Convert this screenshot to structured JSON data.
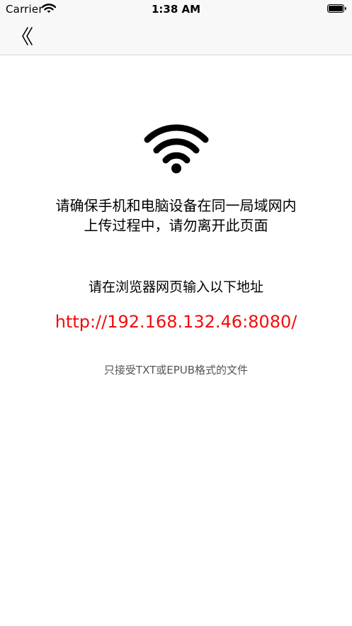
{
  "status_bar": {
    "carrier": "Carrier",
    "time": "1:38 AM",
    "wifi_icon": "wifi-icon",
    "battery_icon": "battery-icon"
  },
  "nav": {
    "back_icon": "chevron-left-icon"
  },
  "content": {
    "wifi_icon": "wifi-icon",
    "message_line1": "请确保手机和电脑设备在同一局域网内",
    "message_line2": "上传过程中，请勿离开此页面",
    "instruction": "请在浏览器网页输入以下地址",
    "address": "http://192.168.132.46:8080/",
    "note": "只接受TXT或EPUB格式的文件"
  },
  "colors": {
    "address": "#f20c0c",
    "note": "#555555",
    "bar_background": "#f8f8f8"
  }
}
